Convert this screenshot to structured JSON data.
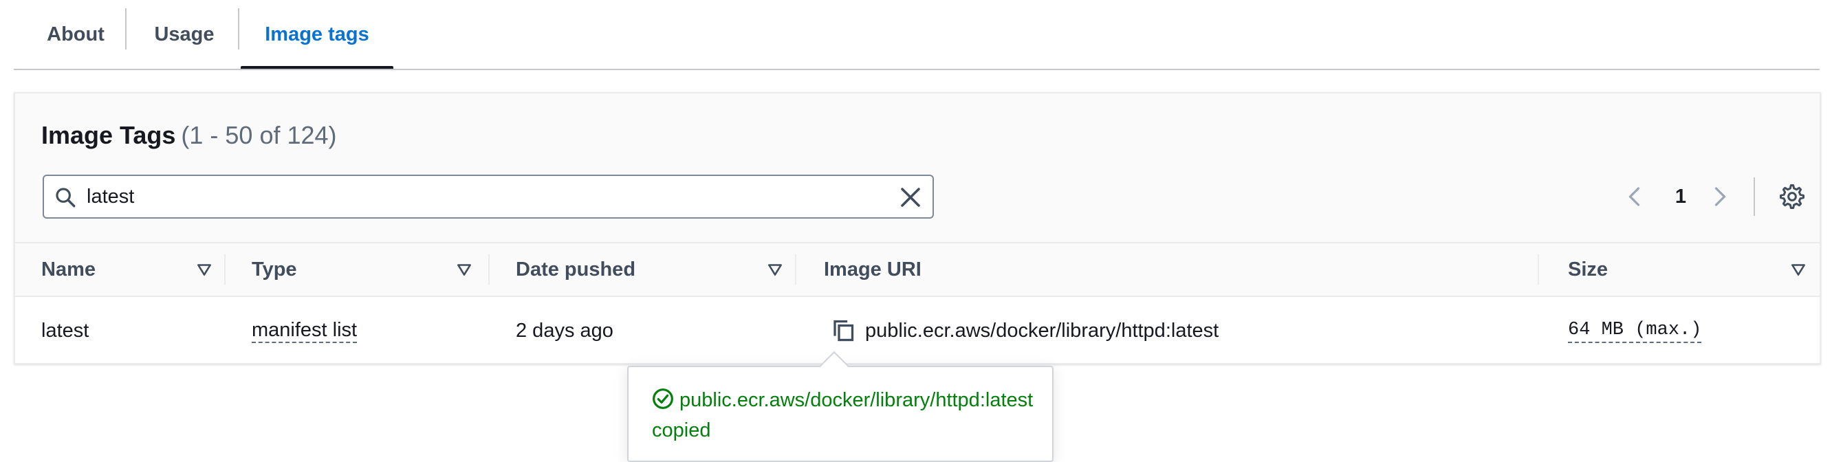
{
  "tabs": [
    {
      "label": "About"
    },
    {
      "label": "Usage"
    },
    {
      "label": "Image tags",
      "active": true
    }
  ],
  "panel": {
    "title": "Image Tags",
    "count": "(1 - 50 of 124)"
  },
  "search": {
    "value": "latest"
  },
  "pagination": {
    "current_page": "1"
  },
  "table": {
    "columns": [
      "Name",
      "Type",
      "Date pushed",
      "Image URI",
      "Size"
    ],
    "rows": [
      {
        "name": "latest",
        "type": "manifest list",
        "date_pushed": "2 days ago",
        "image_uri": "public.ecr.aws/docker/library/httpd:latest",
        "size": "64 MB (max.)"
      }
    ]
  },
  "popover": {
    "message": "public.ecr.aws/docker/library/httpd:latest copied"
  },
  "colors": {
    "accent": "#0972d3",
    "success": "#037f0c",
    "text": "#16191f",
    "muted": "#414d5c"
  },
  "icons": [
    "search-icon",
    "close-icon",
    "chevron-left-icon",
    "chevron-right-icon",
    "gear-icon",
    "sort-icon",
    "copy-icon",
    "check-circle-icon"
  ]
}
